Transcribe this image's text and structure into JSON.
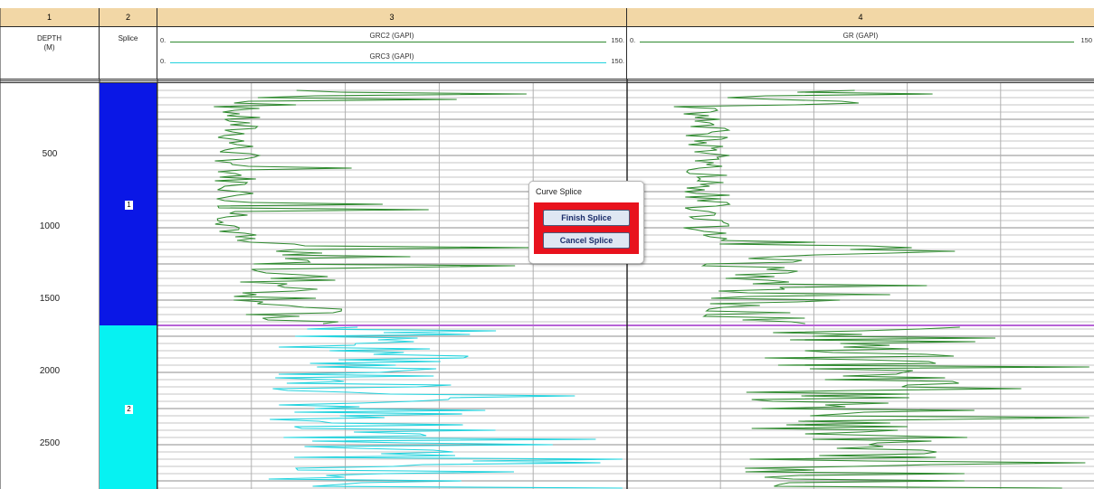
{
  "columns": [
    {
      "num": "1",
      "title_line1": "DEPTH",
      "title_line2": "(M)"
    },
    {
      "num": "2",
      "title_line1": "Splice"
    },
    {
      "num": "3"
    },
    {
      "num": "4"
    }
  ],
  "track3": {
    "curves": [
      {
        "name": "GRC2 (GAPI)",
        "min": "0.",
        "max": "150.",
        "color": "#2f8a2f"
      },
      {
        "name": "GRC3 (GAPI)",
        "min": "0.",
        "max": "150.",
        "color": "#22d3de"
      }
    ]
  },
  "track4": {
    "curves": [
      {
        "name": "GR (GAPI)",
        "min": "0.",
        "max": "150",
        "color": "#2f8a2f"
      }
    ]
  },
  "depth_labels": [
    "500",
    "1000",
    "1500",
    "2000",
    "2500"
  ],
  "splice_segments": [
    {
      "label": "1",
      "color": "#0a17e6"
    },
    {
      "label": "2",
      "color": "#06f2f2"
    }
  ],
  "splice_line_color": "#b764d6",
  "popup": {
    "title": "Curve Splice",
    "finish_label": "Finish Splice",
    "cancel_label": "Cancel Splice"
  }
}
